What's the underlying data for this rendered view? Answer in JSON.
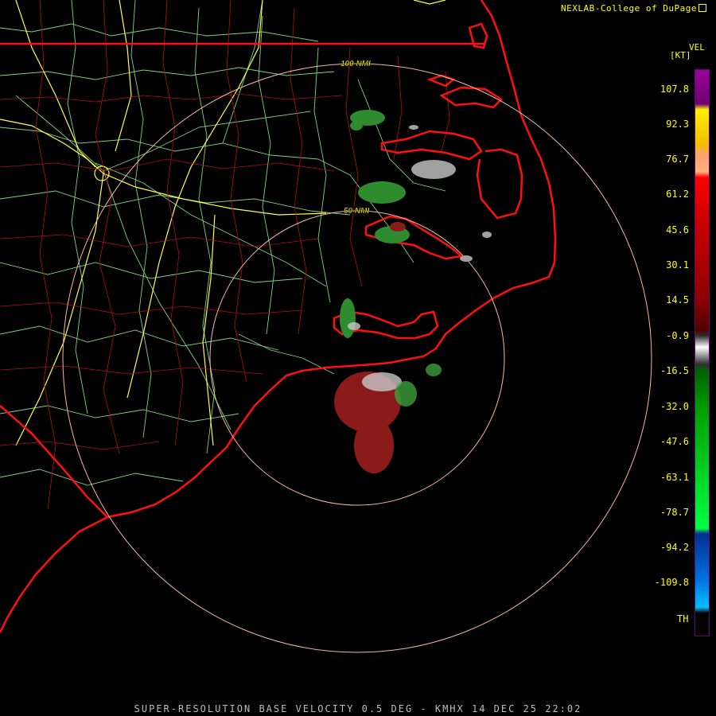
{
  "header": {
    "credit": "NEXLAB-College of DuPage"
  },
  "map": {
    "range_labels": [
      {
        "label": "100 NMI"
      },
      {
        "label": "50 NMI"
      }
    ],
    "colors": {
      "background": "#000000",
      "county_lines": "#b01010",
      "state_lines": "#ff1010",
      "coastline": "#ff1010",
      "highways_major": "#ffff40",
      "roads": "#90e890",
      "range_rings": "#f4b8a0",
      "range_label_text": "#ffff00"
    }
  },
  "legend": {
    "title": "VEL",
    "unit": "[KT]",
    "ticks": [
      "107.8",
      "92.3",
      "76.7",
      "61.2",
      "45.6",
      "30.1",
      "14.5",
      "-0.9",
      "-16.5",
      "-32.0",
      "-47.6",
      "-63.1",
      "-78.7",
      "-94.2",
      "-109.8"
    ],
    "th_label": "TH"
  },
  "footer": {
    "product": "SUPER-RESOLUTION BASE VELOCITY 0.5 DEG - KMHX 14 DEC 25 22:02"
  }
}
